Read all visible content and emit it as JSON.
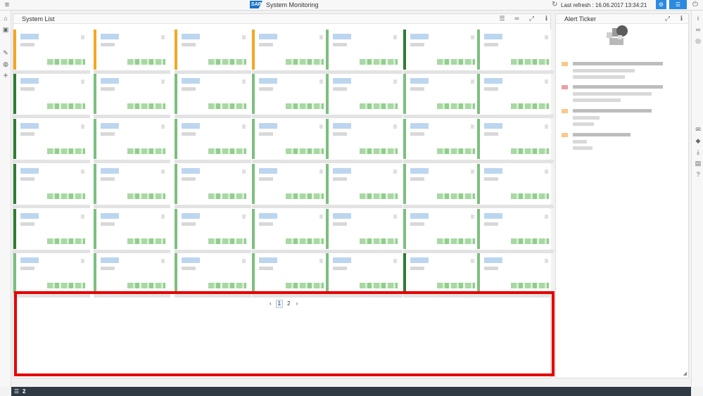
{
  "shell": {
    "title": "System Monitoring",
    "logo_text": "SAP",
    "refresh_text": "Last refresh : 16.06.2017 13:34:21",
    "icons": {
      "menu": "menu-icon",
      "refresh": "refresh-icon",
      "settings": "settings-icon",
      "notifications": "notifications-icon",
      "power": "power-icon"
    }
  },
  "system_list": {
    "title": "System List",
    "header_icons": [
      "list-icon",
      "binoculars-icon",
      "fullscreen-icon",
      "info-icon"
    ],
    "pager": {
      "prev": "‹",
      "pages": [
        "1",
        "2"
      ],
      "current": "1",
      "next": "›"
    }
  },
  "alert_ticker": {
    "title": "Alert Ticker",
    "header_icons": [
      "fullscreen-icon",
      "info-icon"
    ]
  },
  "bottom_bar": {
    "count": "2"
  },
  "colors": {
    "ok": "#2e7d32",
    "light_ok": "#7cbf7f",
    "warning": "#f5a623",
    "critical": "#e8a1a1",
    "highlight": "#e60000",
    "accent": "#2a8ae0"
  }
}
